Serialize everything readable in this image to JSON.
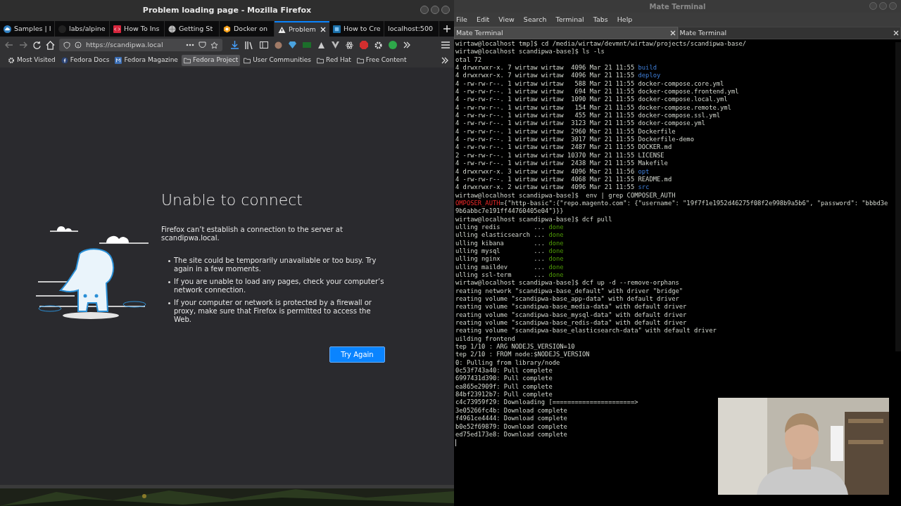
{
  "browser": {
    "title": "Problem loading page - Mozilla Firefox",
    "tabs": [
      {
        "label": "Samples | I",
        "selected": false
      },
      {
        "label": "labs/alpine",
        "selected": false
      },
      {
        "label": "How To Ins",
        "selected": false
      },
      {
        "label": "Getting St",
        "selected": false
      },
      {
        "label": "Docker on",
        "selected": false
      },
      {
        "label": "Problem",
        "selected": true
      },
      {
        "label": "How to Cre",
        "selected": false
      },
      {
        "label": "localhost:500",
        "selected": false
      }
    ],
    "url": "https://scandipwa.local",
    "bookmarks": [
      {
        "label": "Most Visited",
        "hovered": false
      },
      {
        "label": "Fedora Docs",
        "hovered": false
      },
      {
        "label": "Fedora Magazine",
        "hovered": false
      },
      {
        "label": "Fedora Project",
        "hovered": true
      },
      {
        "label": "User Communities",
        "hovered": false
      },
      {
        "label": "Red Hat",
        "hovered": false
      },
      {
        "label": "Free Content",
        "hovered": false
      }
    ],
    "error": {
      "heading": "Unable to connect",
      "message": "Firefox can’t establish a connection to the server at scandipwa.local.",
      "bullets": [
        "The site could be temporarily unavailable or too busy. Try again in a few moments.",
        "If you are unable to load any pages, check your computer’s network connection.",
        "If your computer or network is protected by a firewall or proxy, make sure that Firefox is permitted to access the Web."
      ],
      "button": "Try Again"
    }
  },
  "terminal": {
    "title": "Mate Terminal",
    "menu": [
      "File",
      "Edit",
      "View",
      "Search",
      "Terminal",
      "Tabs",
      "Help"
    ],
    "tabs": [
      {
        "label": "Mate Terminal",
        "selected": true
      },
      {
        "label": "Mate Terminal",
        "selected": false
      }
    ],
    "lines": [
      [
        {
          "text": "wirtaw@localhost tmp]$ cd /media/wirtaw/devmnt/wirtaw/projects/scandipwa-base/",
          "kind": "plain"
        }
      ],
      [
        {
          "text": "wirtaw@localhost scandipwa-base]$ ls -ls",
          "kind": "plain"
        }
      ],
      [
        {
          "text": "otal 72",
          "kind": "plain"
        }
      ],
      [
        {
          "text": "4 drwxrwxr-x. 7 wirtaw wirtaw  4096 Mar 21 11:55 ",
          "kind": "plain"
        },
        {
          "text": "build",
          "kind": "dir"
        }
      ],
      [
        {
          "text": "4 drwxrwxr-x. 7 wirtaw wirtaw  4096 Mar 21 11:55 ",
          "kind": "plain"
        },
        {
          "text": "deploy",
          "kind": "dir"
        }
      ],
      [
        {
          "text": "4 -rw-rw-r--. 1 wirtaw wirtaw   588 Mar 21 11:55 docker-compose.core.yml",
          "kind": "plain"
        }
      ],
      [
        {
          "text": "4 -rw-rw-r--. 1 wirtaw wirtaw   694 Mar 21 11:55 docker-compose.frontend.yml",
          "kind": "plain"
        }
      ],
      [
        {
          "text": "4 -rw-rw-r--. 1 wirtaw wirtaw  1090 Mar 21 11:55 docker-compose.local.yml",
          "kind": "plain"
        }
      ],
      [
        {
          "text": "4 -rw-rw-r--. 1 wirtaw wirtaw   154 Mar 21 11:55 docker-compose.remote.yml",
          "kind": "plain"
        }
      ],
      [
        {
          "text": "4 -rw-rw-r--. 1 wirtaw wirtaw   455 Mar 21 11:55 docker-compose.ssl.yml",
          "kind": "plain"
        }
      ],
      [
        {
          "text": "4 -rw-rw-r--. 1 wirtaw wirtaw  3123 Mar 21 11:55 docker-compose.yml",
          "kind": "plain"
        }
      ],
      [
        {
          "text": "4 -rw-rw-r--. 1 wirtaw wirtaw  2960 Mar 21 11:55 Dockerfile",
          "kind": "plain"
        }
      ],
      [
        {
          "text": "4 -rw-rw-r--. 1 wirtaw wirtaw  3017 Mar 21 11:55 Dockerfile-demo",
          "kind": "plain"
        }
      ],
      [
        {
          "text": "4 -rw-rw-r--. 1 wirtaw wirtaw  2487 Mar 21 11:55 DOCKER.md",
          "kind": "plain"
        }
      ],
      [
        {
          "text": "2 -rw-rw-r--. 1 wirtaw wirtaw 10370 Mar 21 11:55 LICENSE",
          "kind": "plain"
        }
      ],
      [
        {
          "text": "4 -rw-rw-r--. 1 wirtaw wirtaw  2438 Mar 21 11:55 Makefile",
          "kind": "plain"
        }
      ],
      [
        {
          "text": "4 drwxrwxr-x. 3 wirtaw wirtaw  4096 Mar 21 11:56 ",
          "kind": "plain"
        },
        {
          "text": "opt",
          "kind": "dir"
        }
      ],
      [
        {
          "text": "4 -rw-rw-r--. 1 wirtaw wirtaw  4068 Mar 21 11:55 README.md",
          "kind": "plain"
        }
      ],
      [
        {
          "text": "4 drwxrwxr-x. 2 wirtaw wirtaw  4096 Mar 21 11:55 ",
          "kind": "plain"
        },
        {
          "text": "src",
          "kind": "dir"
        }
      ],
      [
        {
          "text": "wirtaw@localhost scandipwa-base]$  env | grep COMPOSER_AUTH",
          "kind": "plain"
        }
      ],
      [
        {
          "text": "OMPOSER_AUTH",
          "kind": "error"
        },
        {
          "text": "={\"http-basic\":{\"repo.magento.com\": {\"username\": \"19f7f1e1952d46275f08f2e998b9a5b6\", \"password\": \"bbbd3e",
          "kind": "plain"
        }
      ],
      [
        {
          "text": "9b6abbc7e191ff44760405e04\"}}}",
          "kind": "plain"
        }
      ],
      [
        {
          "text": "wirtaw@localhost scandipwa-base]$ dcf pull",
          "kind": "plain"
        }
      ],
      [
        {
          "text": "ulling redis         ... ",
          "kind": "plain"
        },
        {
          "text": "done",
          "kind": "ok"
        }
      ],
      [
        {
          "text": "ulling elasticsearch ... ",
          "kind": "plain"
        },
        {
          "text": "done",
          "kind": "ok"
        }
      ],
      [
        {
          "text": "ulling kibana        ... ",
          "kind": "plain"
        },
        {
          "text": "done",
          "kind": "ok"
        }
      ],
      [
        {
          "text": "ulling mysql         ... ",
          "kind": "plain"
        },
        {
          "text": "done",
          "kind": "ok"
        }
      ],
      [
        {
          "text": "ulling nginx         ... ",
          "kind": "plain"
        },
        {
          "text": "done",
          "kind": "ok"
        }
      ],
      [
        {
          "text": "ulling maildev       ... ",
          "kind": "plain"
        },
        {
          "text": "done",
          "kind": "ok"
        }
      ],
      [
        {
          "text": "ulling ssl-term      ... ",
          "kind": "plain"
        },
        {
          "text": "done",
          "kind": "ok"
        }
      ],
      [
        {
          "text": "wirtaw@localhost scandipwa-base]$ dcf up -d --remove-orphans",
          "kind": "plain"
        }
      ],
      [
        {
          "text": "reating network \"scandipwa-base_default\" with driver \"bridge\"",
          "kind": "plain"
        }
      ],
      [
        {
          "text": "reating volume \"scandipwa-base_app-data\" with default driver",
          "kind": "plain"
        }
      ],
      [
        {
          "text": "reating volume \"scandipwa-base_media-data\" with default driver",
          "kind": "plain"
        }
      ],
      [
        {
          "text": "reating volume \"scandipwa-base_mysql-data\" with default driver",
          "kind": "plain"
        }
      ],
      [
        {
          "text": "reating volume \"scandipwa-base_redis-data\" with default driver",
          "kind": "plain"
        }
      ],
      [
        {
          "text": "reating volume \"scandipwa-base_elasticsearch-data\" with default driver",
          "kind": "plain"
        }
      ],
      [
        {
          "text": "uilding frontend",
          "kind": "plain"
        }
      ],
      [
        {
          "text": "tep 1/10 : ARG NODEJS_VERSION=10",
          "kind": "plain"
        }
      ],
      [
        {
          "text": "tep 2/10 : FROM node:$NODEJS_VERSION",
          "kind": "plain"
        }
      ],
      [
        {
          "text": "0: Pulling from library/node",
          "kind": "plain"
        }
      ],
      [
        {
          "text": "0c53f743a40: Pull complete",
          "kind": "plain"
        }
      ],
      [
        {
          "text": "6997431d390: Pull complete",
          "kind": "plain"
        }
      ],
      [
        {
          "text": "ea865e2909f: Pull complete",
          "kind": "plain"
        }
      ],
      [
        {
          "text": "84bf23912b7: Pull complete",
          "kind": "plain"
        }
      ],
      [
        {
          "text": "c4c73959f29: Downloading [======================>",
          "kind": "plain"
        }
      ],
      [
        {
          "text": "3e05266fc4b: Download complete",
          "kind": "plain"
        }
      ],
      [
        {
          "text": "f4961ce4444: Download complete",
          "kind": "plain"
        }
      ],
      [
        {
          "text": "b0e52f69879: Download complete",
          "kind": "plain"
        }
      ],
      [
        {
          "text": "ed75ed173e8: Download complete",
          "kind": "plain"
        }
      ]
    ]
  }
}
